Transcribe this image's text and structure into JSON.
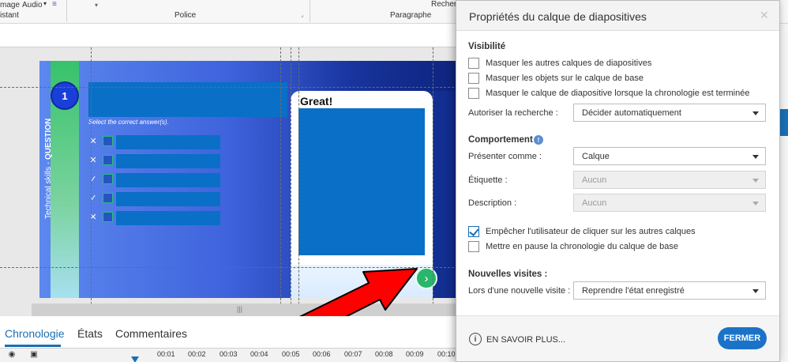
{
  "ribbon": {
    "image_label": "mage",
    "audio_label": "Audio",
    "assistant_label": "istant",
    "font_group": "Police",
    "paragraph_group": "Paragraphe",
    "search_label": "Recher"
  },
  "slide": {
    "question_number": "1",
    "vertical_text_pre": "Technical skills - ",
    "vertical_text_bold": "QUESTION",
    "instruction": "Select the correct answer(s).",
    "answer_marks": [
      "✕",
      "✕",
      "✓",
      "✓",
      "✕"
    ],
    "feedback_title": "Great!",
    "next_icon": "›"
  },
  "timeline": {
    "tabs": [
      "Chronologie",
      "États",
      "Commentaires"
    ],
    "ticks": [
      "00:01",
      "00:02",
      "00:03",
      "00:04",
      "00:05",
      "00:06",
      "00:07",
      "00:08",
      "00:09",
      "00:10"
    ]
  },
  "dialog": {
    "title": "Propriétés du calque de diapositives",
    "close_icon": "✕",
    "visibility": {
      "heading": "Visibilité",
      "options": [
        {
          "label": "Masquer les autres calques de diapositives",
          "checked": false
        },
        {
          "label": "Masquer les objets sur le calque de base",
          "checked": false
        },
        {
          "label": "Masquer le calque de diapositive lorsque la chronologie est terminée",
          "checked": false
        }
      ],
      "search_label": "Autoriser la recherche :",
      "search_value": "Décider automatiquement"
    },
    "behavior": {
      "heading": "Comportement",
      "info_icon": "!",
      "present_label": "Présenter comme :",
      "present_value": "Calque",
      "tag_label": "Étiquette :",
      "tag_value": "Aucun",
      "desc_label": "Description :",
      "desc_value": "Aucun",
      "options": [
        {
          "label": "Empêcher l'utilisateur de cliquer sur les autres calques",
          "checked": true
        },
        {
          "label": "Mettre en pause la chronologie du calque de base",
          "checked": false
        }
      ]
    },
    "revisits": {
      "heading": "Nouvelles visites :",
      "label": "Lors d'une nouvelle visite :",
      "value": "Reprendre l'état enregistré"
    },
    "footer": {
      "learn_more": "EN SAVOIR PLUS...",
      "close_button": "FERMER"
    }
  },
  "colors": {
    "accent": "#1a73c8",
    "arrow_fill": "#ff0000",
    "answer_field": "#0a6fc6",
    "next_button": "#2ab56c"
  }
}
